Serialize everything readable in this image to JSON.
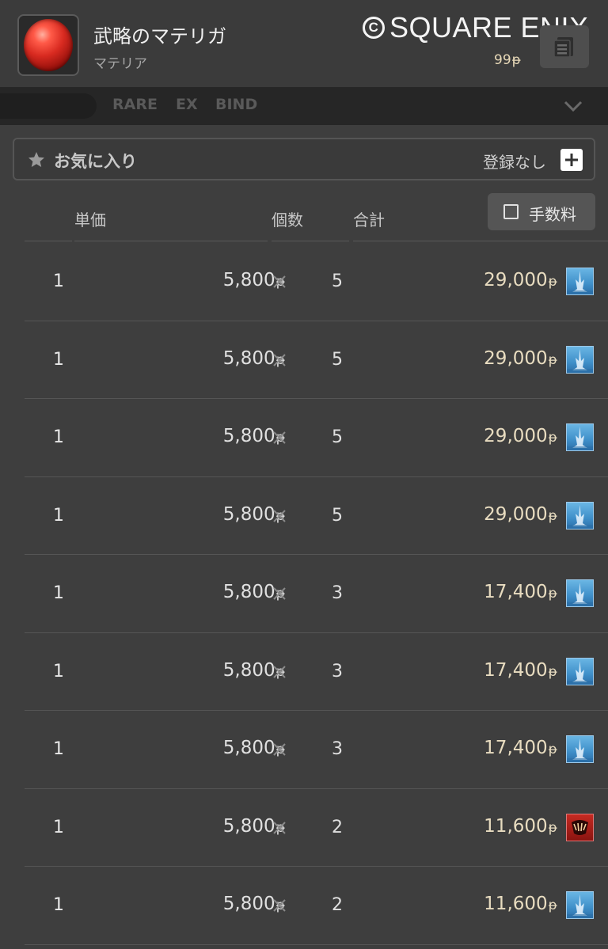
{
  "header": {
    "item_name": "武略のマテリガ",
    "item_category": "マテリア",
    "copyright": "SQUARE ENIX",
    "copyright_mark": "C",
    "small_price": "99",
    "gil_symbol": "ᵽ"
  },
  "filter": {
    "tags": [
      "RARE",
      "EX",
      "BIND"
    ]
  },
  "favorite": {
    "label": "お気に入り",
    "status": "登録なし"
  },
  "columns": {
    "unit_price": "単価",
    "count": "個数",
    "total": "合計",
    "fee_label": "手数料"
  },
  "colors": {
    "background": "#3e3e3e",
    "accent_gold": "#e8dcc0",
    "world_ice": "#4a9fd8",
    "world_red": "#b01e18"
  },
  "listings": [
    {
      "index": "1",
      "unit": "5,800",
      "count": "5",
      "total": "29,000",
      "world_icon": "ice-spire-icon"
    },
    {
      "index": "1",
      "unit": "5,800",
      "count": "5",
      "total": "29,000",
      "world_icon": "ice-spire-icon"
    },
    {
      "index": "1",
      "unit": "5,800",
      "count": "5",
      "total": "29,000",
      "world_icon": "ice-spire-icon"
    },
    {
      "index": "1",
      "unit": "5,800",
      "count": "5",
      "total": "29,000",
      "world_icon": "ice-spire-icon"
    },
    {
      "index": "1",
      "unit": "5,800",
      "count": "3",
      "total": "17,400",
      "world_icon": "ice-spire-icon"
    },
    {
      "index": "1",
      "unit": "5,800",
      "count": "3",
      "total": "17,400",
      "world_icon": "ice-spire-icon"
    },
    {
      "index": "1",
      "unit": "5,800",
      "count": "3",
      "total": "17,400",
      "world_icon": "ice-spire-icon"
    },
    {
      "index": "1",
      "unit": "5,800",
      "count": "2",
      "total": "11,600",
      "world_icon": "red-crest-icon"
    },
    {
      "index": "1",
      "unit": "5,800",
      "count": "2",
      "total": "11,600",
      "world_icon": "ice-spire-icon"
    }
  ]
}
